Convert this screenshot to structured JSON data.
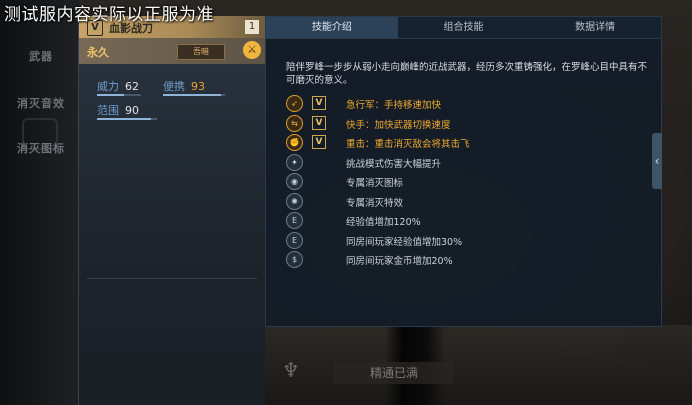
{
  "watermark": "测试服内容实际以正服为准",
  "side_menu": [
    "武器",
    "消灭音效",
    "消灭图标"
  ],
  "weapon": {
    "badge": "V",
    "name": "血影战刀",
    "level": "1",
    "duration": "永久",
    "tag_label": "吾暗",
    "stats": [
      {
        "label": "威力",
        "value": "62",
        "fill": 0.62
      },
      {
        "label": "便携",
        "value": "93",
        "fill": 0.93
      },
      {
        "label": "范围",
        "value": "90",
        "fill": 0.9
      }
    ]
  },
  "tabs": [
    "技能介绍",
    "组合技能",
    "数据详情"
  ],
  "description": "陪伴罗峰一步步从弱小走向巅峰的近战武器，经历多次重铸强化，在罗峰心目中具有不可磨灭的意义。",
  "features": [
    {
      "icon": "sprint-icon",
      "badge": "V",
      "text": "急行军：手持移速加快",
      "highlight": true
    },
    {
      "icon": "quick-switch-icon",
      "badge": "V",
      "text": "快手：加快武器切换速度",
      "highlight": true
    },
    {
      "icon": "heavy-strike-icon",
      "badge": "V",
      "text": "重击：重击消灭敌会将其击飞",
      "highlight": true
    },
    {
      "icon": "challenge-damage-icon",
      "badge": "",
      "text": "挑战模式伤害大幅提升",
      "highlight": false
    },
    {
      "icon": "kill-icon-emblem",
      "badge": "",
      "text": "专属消灭图标",
      "highlight": false
    },
    {
      "icon": "kill-effect-icon",
      "badge": "",
      "text": "专属消灭特效",
      "highlight": false
    },
    {
      "icon": "exp-icon",
      "badge": "",
      "text": "经验值增加120%",
      "highlight": false
    },
    {
      "icon": "room-exp-icon",
      "badge": "",
      "text": "同房间玩家经验值增加30%",
      "highlight": false
    },
    {
      "icon": "room-gold-icon",
      "badge": "",
      "text": "同房间玩家金币增加20%",
      "highlight": false
    }
  ],
  "mastery_label": "精通已满",
  "colors": {
    "accent_gold": "#f0a830",
    "panel_bg": "#131d27",
    "stat_blue": "#6f9ccc"
  }
}
